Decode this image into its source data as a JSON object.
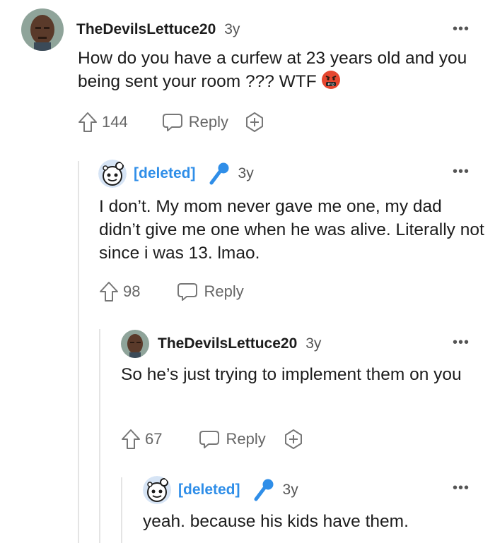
{
  "colors": {
    "deleted_user": "#2f8ee8",
    "thread_line": "#e4e4e4",
    "text": "#1c1c1c",
    "meta": "#666666"
  },
  "comments": [
    {
      "username": "TheDevilsLettuce20",
      "age": "3y",
      "text": "How do you have a curfew at 23 years old and you being sent your room ??? WTF",
      "emoji": "angry-face-with-symbols-icon",
      "votes": "144",
      "reply_label": "Reply",
      "award_icon": "award-plus-icon"
    },
    {
      "username": "[deleted]",
      "age": "3y",
      "flair_icon": "microphone-icon",
      "text": "I don’t. My mom never gave me one, my dad didn’t give me one when he was alive. Literally not since i was 13. lmao.",
      "votes": "98",
      "reply_label": "Reply"
    },
    {
      "username": "TheDevilsLettuce20",
      "age": "3y",
      "text": "So he’s just trying to implement them on you",
      "votes": "67",
      "reply_label": "Reply",
      "award_icon": "award-plus-icon"
    },
    {
      "username": "[deleted]",
      "age": "3y",
      "flair_icon": "microphone-icon",
      "text": "yeah. because his kids have them."
    }
  ],
  "more_label": "•••"
}
